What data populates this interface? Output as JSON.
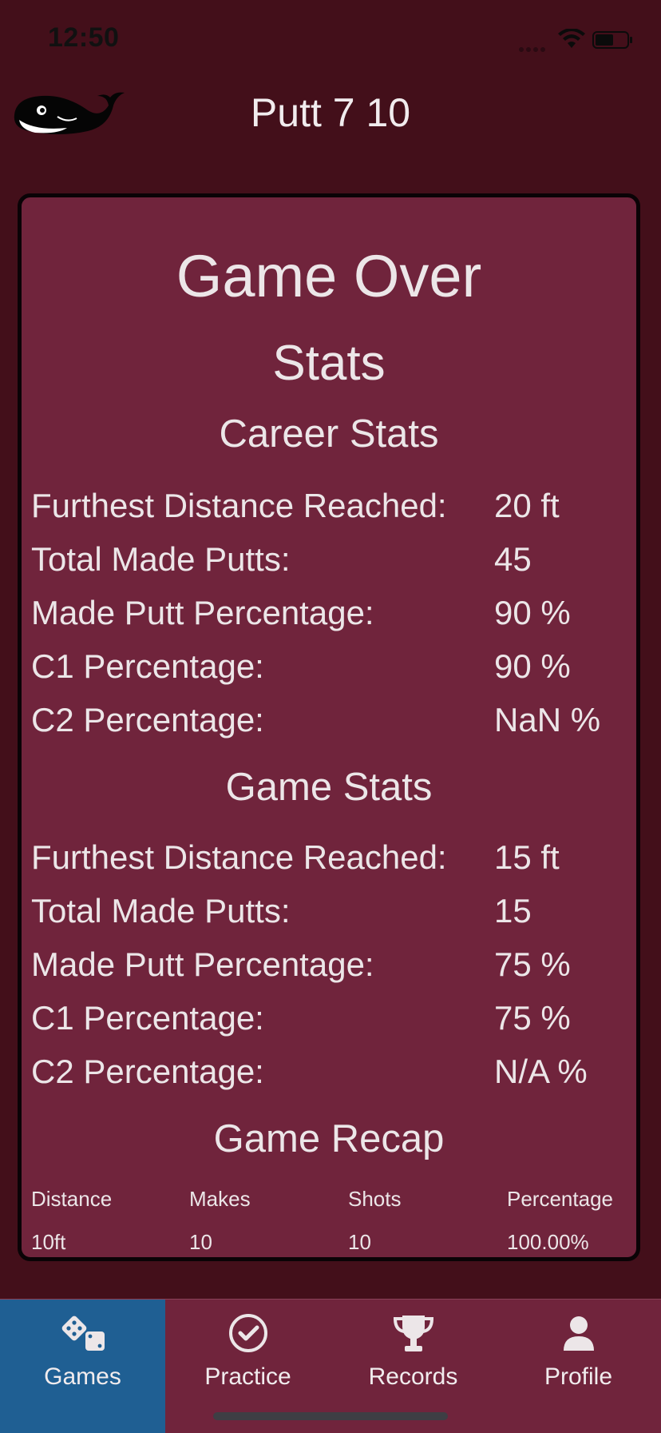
{
  "status_bar": {
    "time": "12:50"
  },
  "header": {
    "title": "Putt 7 10"
  },
  "card": {
    "heading": "Game Over",
    "subheading": "Stats",
    "career": {
      "title": "Career Stats",
      "rows": [
        {
          "label": "Furthest Distance Reached:",
          "value": "20 ft"
        },
        {
          "label": "Total Made Putts:",
          "value": "45"
        },
        {
          "label": "Made Putt Percentage:",
          "value": "90 %"
        },
        {
          "label": "C1 Percentage:",
          "value": "90 %"
        },
        {
          "label": "C2 Percentage:",
          "value": "NaN %"
        }
      ]
    },
    "game": {
      "title": "Game Stats",
      "rows": [
        {
          "label": "Furthest Distance Reached:",
          "value": "15 ft"
        },
        {
          "label": "Total Made Putts:",
          "value": "15"
        },
        {
          "label": "Made Putt Percentage:",
          "value": "75 %"
        },
        {
          "label": "C1 Percentage:",
          "value": "75 %"
        },
        {
          "label": "C2 Percentage:",
          "value": "N/A %"
        }
      ]
    },
    "recap": {
      "title": "Game Recap",
      "headers": [
        "Distance",
        "Makes",
        "Shots",
        "Percentage"
      ],
      "rows": [
        [
          "10ft",
          "10",
          "10",
          "100.00%"
        ]
      ]
    }
  },
  "tabbar": {
    "tabs": [
      {
        "label": "Games",
        "icon": "dice-icon",
        "active": true
      },
      {
        "label": "Practice",
        "icon": "checkmark-circle-icon",
        "active": false
      },
      {
        "label": "Records",
        "icon": "trophy-icon",
        "active": false
      },
      {
        "label": "Profile",
        "icon": "person-icon",
        "active": false
      }
    ]
  },
  "colors": {
    "background": "#430f1a",
    "card": "#70243c",
    "active_tab": "#1f5f93",
    "text": "#ece6e8"
  }
}
